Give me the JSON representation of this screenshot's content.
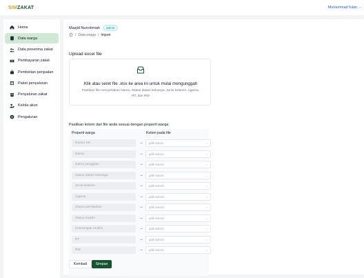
{
  "app": {
    "brand_accent": "SIM",
    "brand_rest": "ZAKAT",
    "user_name": "Muhammad fulan"
  },
  "sidebar": {
    "items": [
      {
        "label": "Home",
        "icon": "home-icon"
      },
      {
        "label": "Data warga",
        "icon": "book-icon",
        "active": true
      },
      {
        "label": "Data penerima zakat",
        "icon": "users-icon"
      },
      {
        "label": "Pembayaran zakat",
        "icon": "money-icon"
      },
      {
        "label": "Pembelian penjualan",
        "icon": "bag-icon"
      },
      {
        "label": "Paket penyaluran",
        "icon": "package-icon"
      },
      {
        "label": "Penyaluran zakat",
        "icon": "box-icon"
      },
      {
        "label": "Kelola akun",
        "icon": "user-manage-icon"
      },
      {
        "label": "Pengaturan",
        "icon": "gear-icon"
      }
    ]
  },
  "header": {
    "user": "Masjid Nurrohmah",
    "role": "admin",
    "breadcrumb": {
      "sep": "/",
      "parent": "Data warga",
      "current": "Import"
    }
  },
  "upload": {
    "title": "Upload excel file",
    "main": "Klik atau seret file .xlsx ke area ini untuk mulai mengunggah",
    "sub": "Pastikan file menyertakan Nama, Status dalam keluarga, Jenis kelamin, Agama, RT, dan RW"
  },
  "mapping": {
    "title": "Pastikan kolom dari file anda sesuai dengan properti warga",
    "header_prop": "Properti warga",
    "header_col": "Kolom pada file",
    "placeholder": "pilih kolom",
    "arrow": "→",
    "chevron": "⌵",
    "rows": [
      "Nomor KK",
      "Nama",
      "Nama panggilan",
      "Status dalam keluarga",
      "Jenis kelamin",
      "Agama",
      "Status pernikahan",
      "Status mukim",
      "Keterangan mukim",
      "RT",
      "RW"
    ]
  },
  "actions": {
    "back": "Kembali",
    "save": "Simpan"
  },
  "colors": {
    "primary": "#14532d",
    "active_bg": "#cfe9d4",
    "link": "#1d64c8",
    "brand_accent": "#c9a227"
  }
}
